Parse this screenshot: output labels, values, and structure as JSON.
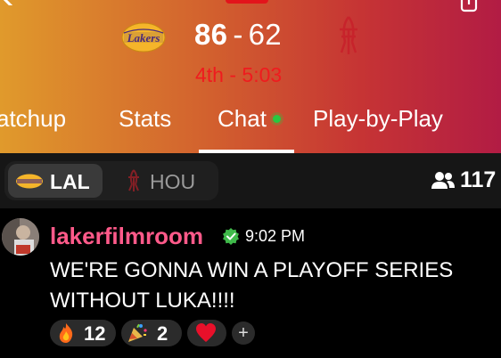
{
  "header": {
    "home_team_logo": "Lakers",
    "away_team_logo": "rockets-logo-icon",
    "home_score": "86",
    "separator": "-",
    "away_score": "62",
    "game_clock": "4th - 5:03",
    "colors": {
      "gradient_left": "#e09a2c",
      "gradient_right": "#b21c44",
      "clock": "#ef1b1e",
      "live_dot": "#28c840"
    }
  },
  "tabs": [
    {
      "label": "atchup"
    },
    {
      "label": "Stats"
    },
    {
      "label": "Chat",
      "active": true,
      "live": true
    },
    {
      "label": "Play-by-Play"
    }
  ],
  "team_toggle": {
    "lal_label": "LAL",
    "hou_label": "HOU",
    "selected": "LAL"
  },
  "viewers": {
    "count": "117",
    "icon": "users-icon"
  },
  "message": {
    "username": "lakerfilmroom",
    "verified": true,
    "timestamp": "9:02 PM",
    "text": "WE'RE GONNA WIN A PLAYOFF SERIES WITHOUT LUKA!!!!",
    "username_color": "#ff5a8a",
    "reactions": [
      {
        "icon": "fire-emoji",
        "count": "12"
      },
      {
        "icon": "party-popper-emoji",
        "count": "2"
      },
      {
        "icon": "red-heart-emoji",
        "count": ""
      }
    ],
    "add_reaction_label": "+"
  }
}
